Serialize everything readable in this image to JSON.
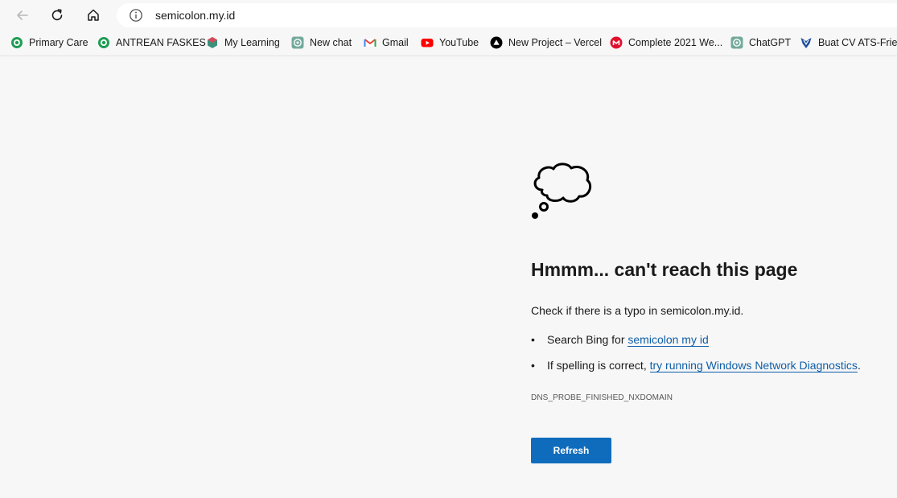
{
  "browser": {
    "url": "semicolon.my.id"
  },
  "bookmarks": [
    {
      "label": "Primary Care",
      "icon": "bpjs-green-icon"
    },
    {
      "label": "ANTREAN FASKES",
      "icon": "bpjs-green-icon"
    },
    {
      "label": "My Learning",
      "icon": "codecademy-icon"
    },
    {
      "label": "New chat",
      "icon": "openai-icon"
    },
    {
      "label": "Gmail",
      "icon": "gmail-icon"
    },
    {
      "label": "YouTube",
      "icon": "youtube-icon"
    },
    {
      "label": "New Project – Vercel",
      "icon": "vercel-icon"
    },
    {
      "label": "Complete 2021 We...",
      "icon": "udemy-icon"
    },
    {
      "label": "ChatGPT",
      "icon": "openai-icon"
    },
    {
      "label": "Buat CV ATS-Frien",
      "icon": "cv-builder-icon"
    }
  ],
  "error": {
    "title": "Hmmm... can't reach this page",
    "lead": "Check if there is a typo in semicolon.my.id.",
    "bullet1_prefix": "Search Bing for ",
    "bullet1_link": "semicolon my id",
    "bullet2_prefix": "If spelling is correct, ",
    "bullet2_link": "try running Windows Network Diagnostics",
    "bullet2_suffix": ".",
    "code": "DNS_PROBE_FINISHED_NXDOMAIN",
    "refresh_label": "Refresh"
  },
  "colors": {
    "accent": "#0f6cbd",
    "link": "#0f5ea8",
    "background": "#f7f7f7"
  }
}
